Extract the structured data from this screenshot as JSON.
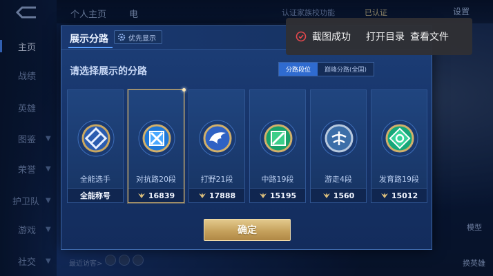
{
  "background": {
    "top_tabs": [
      "个人主页",
      "电"
    ],
    "top_right_text": "认证家族校功能",
    "top_right_badge": "已认证",
    "settings_label": "设置",
    "nav_items": [
      {
        "label": "主页",
        "active": true,
        "chevron": false
      },
      {
        "label": "战绩",
        "active": false,
        "chevron": false
      },
      {
        "label": "英雄",
        "active": false,
        "chevron": false
      },
      {
        "label": "图鉴",
        "active": false,
        "chevron": true
      },
      {
        "label": "荣誉",
        "active": false,
        "chevron": true
      },
      {
        "label": "护卫队",
        "active": false,
        "chevron": true
      },
      {
        "label": "游戏",
        "active": false,
        "chevron": true
      },
      {
        "label": "社交",
        "active": false,
        "chevron": true
      }
    ],
    "right_labels": [
      "模型",
      "换英雄"
    ],
    "bottom_text": "最近访客>"
  },
  "modal": {
    "title": "展示分路",
    "priority_chip": "优先显示",
    "subtitle": "请选择展示的分路",
    "segments": [
      {
        "label": "分路段位",
        "active": true
      },
      {
        "label": "巅峰分路(全国)",
        "active": false
      }
    ],
    "cards": [
      {
        "role": "全能选手",
        "score": "全能称号",
        "has_score_icon": false,
        "selected": false,
        "badge_color": "#7aa3e8",
        "badge_icon": "all-round-badge-icon"
      },
      {
        "role": "对抗路20段",
        "score": "16839",
        "has_score_icon": true,
        "selected": true,
        "badge_color": "#4aa8ff",
        "badge_icon": "clash-lane-badge-icon"
      },
      {
        "role": "打野21段",
        "score": "17888",
        "has_score_icon": true,
        "selected": false,
        "badge_color": "#5aa7ff",
        "badge_icon": "jungle-badge-icon"
      },
      {
        "role": "中路19段",
        "score": "15195",
        "has_score_icon": true,
        "selected": false,
        "badge_color": "#3ccf8a",
        "badge_icon": "mid-lane-badge-icon"
      },
      {
        "role": "游走4段",
        "score": "1560",
        "has_score_icon": true,
        "selected": false,
        "badge_color": "#78a6d8",
        "badge_icon": "roam-badge-icon"
      },
      {
        "role": "发育路19段",
        "score": "15012",
        "has_score_icon": true,
        "selected": false,
        "badge_color": "#36d29a",
        "badge_icon": "farm-lane-badge-icon"
      }
    ],
    "confirm_label": "确定"
  },
  "toast": {
    "message": "截图成功",
    "open_dir": "打开目录",
    "view_file": "查看文件"
  }
}
